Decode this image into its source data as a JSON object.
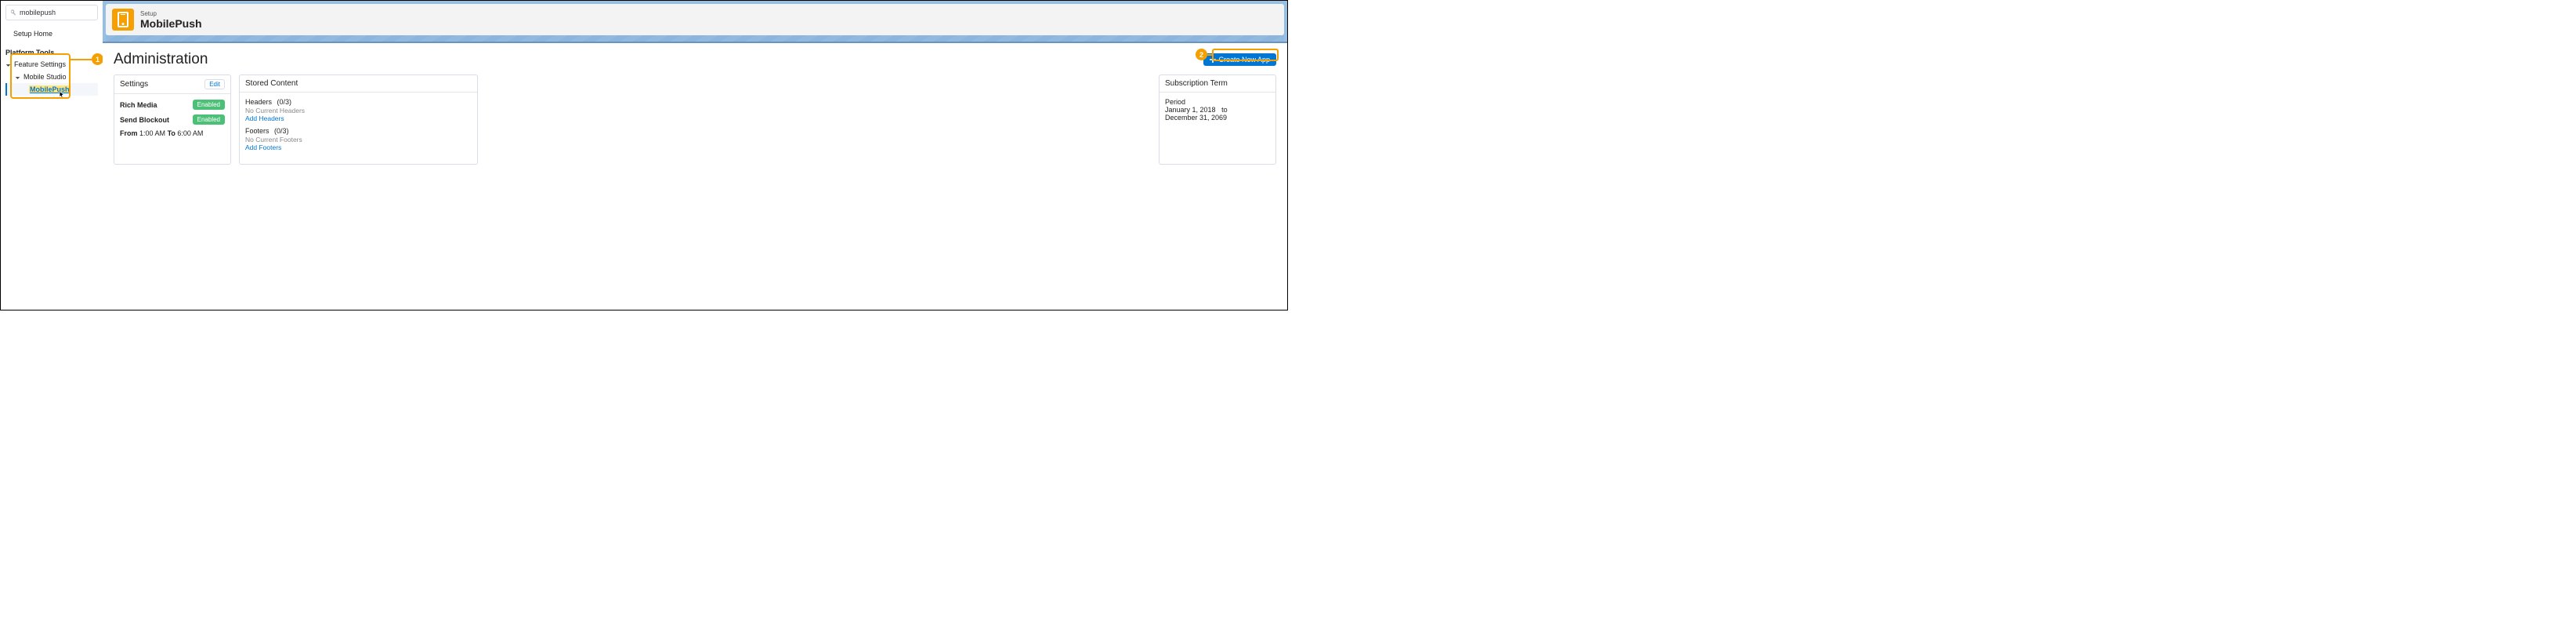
{
  "sidebar": {
    "search_value": "mobilepush",
    "setup_home": "Setup Home",
    "section": "Platform Tools",
    "tree": {
      "feature_settings": "Feature Settings",
      "mobile_studio": "Mobile Studio",
      "mobilepush": "MobilePush"
    }
  },
  "callouts": {
    "one": "1",
    "two": "2"
  },
  "header": {
    "breadcrumb": "Setup",
    "title": "MobilePush"
  },
  "page": {
    "title": "Administration",
    "create_btn": "Create New App"
  },
  "settings": {
    "title": "Settings",
    "edit": "Edit",
    "rich_media": "Rich Media",
    "send_blockout": "Send Blockout",
    "enabled": "Enabled",
    "from_label": "From",
    "from_time": "1:00 AM",
    "to_label": "To",
    "to_time": "6:00 AM"
  },
  "stored": {
    "title": "Stored Content",
    "headers_label": "Headers",
    "headers_count": "(0/3)",
    "no_headers": "No Current Headers",
    "add_headers": "Add Headers",
    "footers_label": "Footers",
    "footers_count": "(0/3)",
    "no_footers": "No Current Footers",
    "add_footers": "Add Footers"
  },
  "sub": {
    "title": "Subscription Term",
    "period_label": "Period",
    "start": "January 1, 2018",
    "to": "to",
    "end": "December 31, 2069"
  }
}
